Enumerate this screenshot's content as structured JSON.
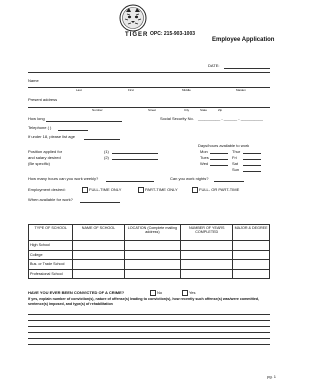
{
  "header": {
    "logo_text": "TIGER",
    "opc": "OPC: 215-903-1003",
    "title": "Employee Application"
  },
  "date_label": "DATE:",
  "name": {
    "label": "Name",
    "sub": [
      "Last",
      "First",
      "Middle",
      "Maiden"
    ]
  },
  "address": {
    "label": "Present address",
    "sub": [
      "Number",
      "Street",
      "City",
      "State",
      "Zip"
    ]
  },
  "how_long": "How long",
  "ssn_label": "Social Security No.",
  "ssn_dashes": "__________ - ______ - __________",
  "telephone": "Telephone (          )",
  "under18": "If under 18, please list age",
  "position": {
    "line1": "Position          applied          for",
    "line2": "and          salary          desired",
    "line3": "(Be specific)",
    "opt1": "(1)",
    "opt2": "(2)"
  },
  "days": {
    "title": "Days/hours available to work",
    "rows": [
      [
        "Mon",
        "Thur"
      ],
      [
        "Tues",
        "Fri"
      ],
      [
        "Wed",
        "Sat"
      ],
      [
        "",
        "Sun"
      ]
    ]
  },
  "hours_weekly": "How many hours can you work weekly?",
  "nights": "Can you work nights?",
  "employment_desired": "Employment desired:",
  "employment_options": [
    "FULL-TIME ONLY",
    "PART-TIME ONLY",
    "FULL- OR PART-TIME"
  ],
  "when_available": "When available for work?",
  "education": {
    "headers": [
      "TYPE OF SCHOOL",
      "NAME OF SCHOOL",
      "LOCATION (Complete mailing address)",
      "NUMBER OF YEARS COMPLETED",
      "MAJOR & DEGREE"
    ],
    "rows": [
      "High School",
      "College",
      "Bus. or Trade School",
      "Professional School"
    ]
  },
  "crime": {
    "question": "HAVE YOU EVER BEEN CONVICTED OF A CRIME?",
    "no": "No",
    "yes": "Yes",
    "explain": "If yes, explain number of conviction(s), nature of offense(s) leading to conviction(s), how recently such offense(s) was/were committed, sentence(s) imposed, and type(s) of rehabilitation"
  },
  "page": "pg. 1"
}
